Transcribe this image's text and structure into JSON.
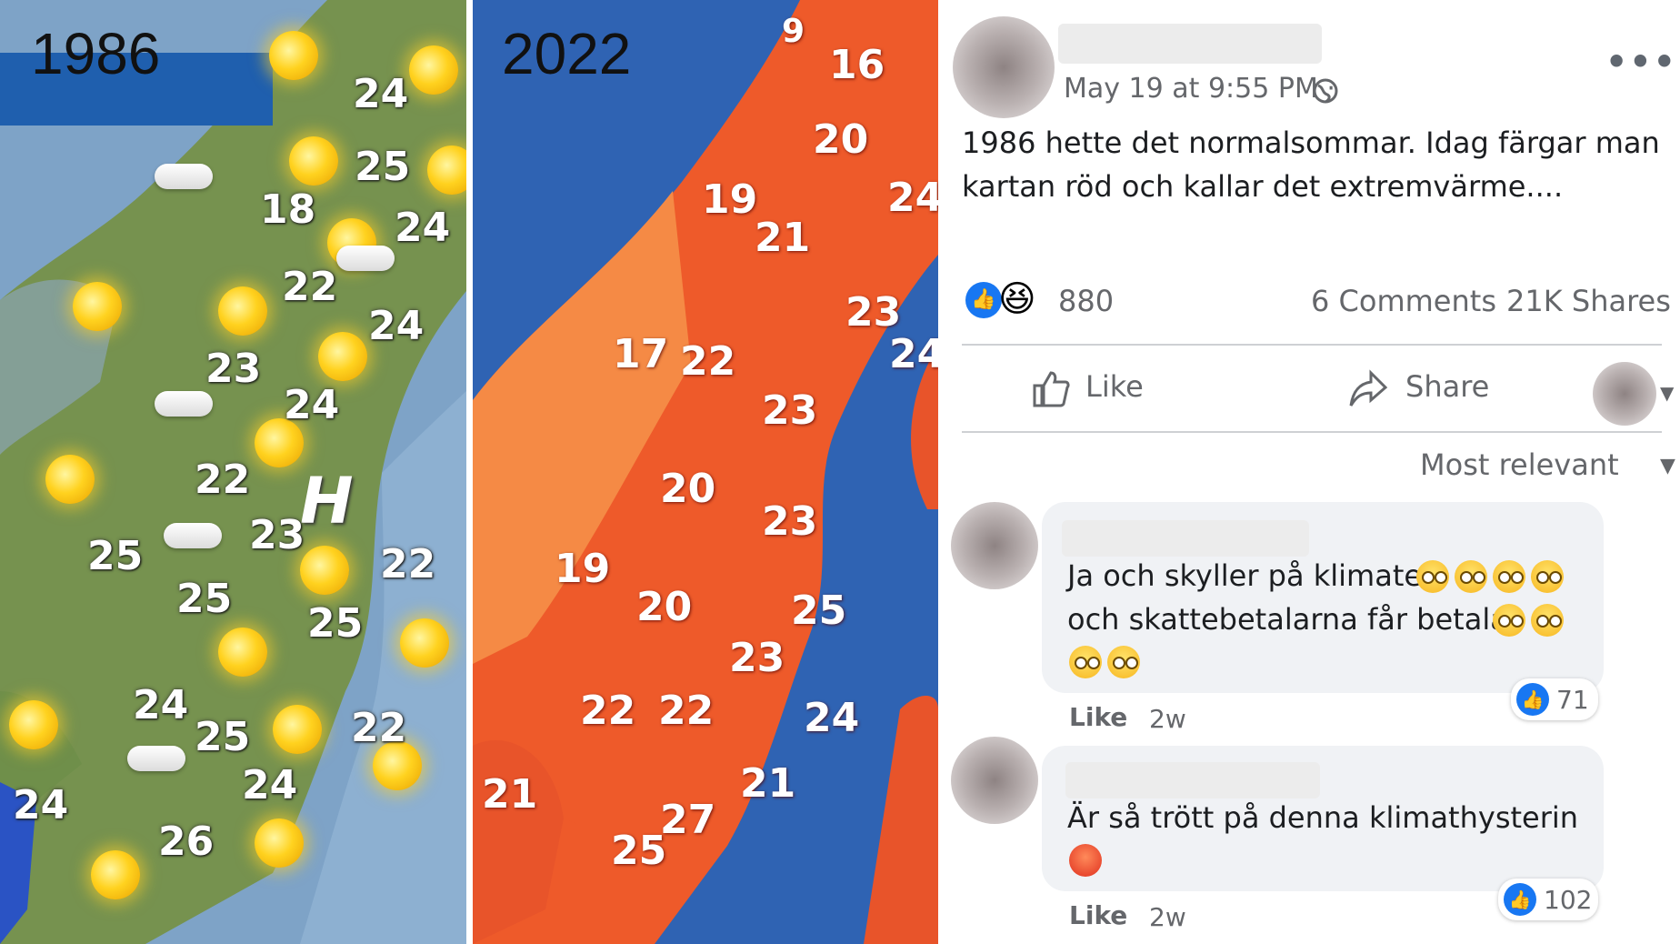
{
  "map_left": {
    "year": "1986",
    "temps": [
      "24",
      "25",
      "18",
      "24",
      "22",
      "24",
      "23",
      "24",
      "22",
      "23",
      "22",
      "25",
      "25",
      "25",
      "24",
      "25",
      "22",
      "24",
      "24",
      "26"
    ]
  },
  "map_right": {
    "year": "2022",
    "temps": [
      "9",
      "16",
      "20",
      "19",
      "24",
      "21",
      "23",
      "17",
      "22",
      "24",
      "23",
      "20",
      "23",
      "19",
      "20",
      "25",
      "23",
      "22",
      "22",
      "24",
      "21",
      "21",
      "27",
      "25"
    ]
  },
  "post": {
    "timestamp": "May 19 at 9:55 PM ·",
    "text_line1": "1986 hette det normalsommar. Idag färgar man",
    "text_line2": "kartan röd och kallar det extremvärme....",
    "reaction_count": "880",
    "comments_count": "6 Comments",
    "shares_count": "21K Shares",
    "like_label": "Like",
    "share_label": "Share",
    "sort_label": "Most relevant",
    "more_icon": "more-dots-icon",
    "colors": {
      "like_blue": "#1877f2",
      "map_2022_hot": "#ee5a2a",
      "sea_2022": "#2f63b3"
    }
  },
  "comments": [
    {
      "line1": "Ja och skyller på klimatet",
      "line2": "och skattebetalarna får betala",
      "like": "Like",
      "time": "2w",
      "likes": "71"
    },
    {
      "line1": "Är så trött på denna klimathysterin",
      "like": "Like",
      "time": "2w",
      "likes": "102"
    }
  ]
}
